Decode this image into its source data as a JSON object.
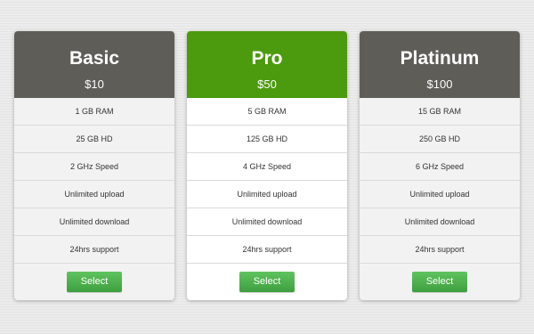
{
  "colors": {
    "header_default": "#5e5d57",
    "header_featured": "#4c9a0e",
    "button": "#4caf4c"
  },
  "plans": [
    {
      "name": "Basic",
      "price": "$10",
      "featured": false,
      "features": [
        "1 GB RAM",
        "25 GB HD",
        "2 GHz Speed",
        "Unlimited upload",
        "Unlimited download",
        "24hrs support"
      ],
      "button_label": "Select"
    },
    {
      "name": "Pro",
      "price": "$50",
      "featured": true,
      "features": [
        "5 GB RAM",
        "125 GB HD",
        "4 GHz Speed",
        "Unlimited upload",
        "Unlimited download",
        "24hrs support"
      ],
      "button_label": "Select"
    },
    {
      "name": "Platinum",
      "price": "$100",
      "featured": false,
      "features": [
        "15 GB RAM",
        "250 GB HD",
        "6 GHz Speed",
        "Unlimited upload",
        "Unlimited download",
        "24hrs support"
      ],
      "button_label": "Select"
    }
  ]
}
